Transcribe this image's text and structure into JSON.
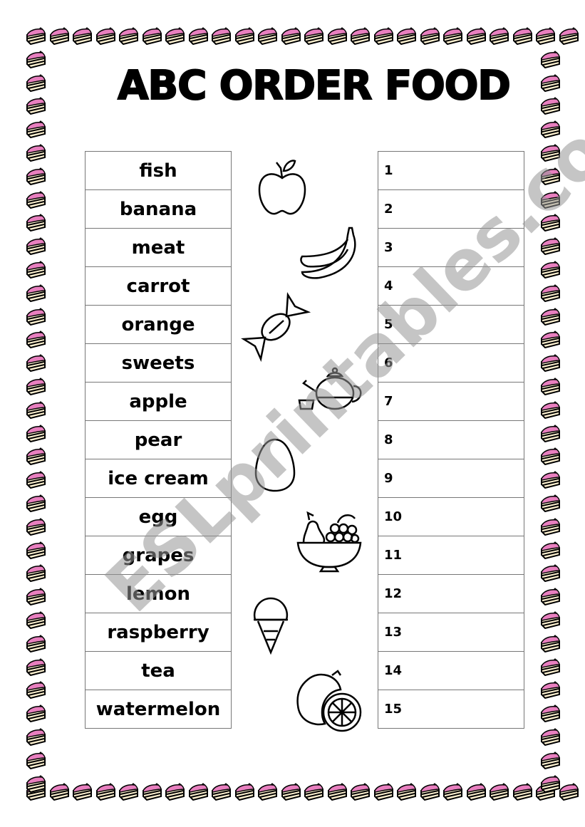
{
  "title": "ABC ORDER FOOD",
  "border_icon": "cake-slice-icon",
  "colors": {
    "cake_frosting": "#e87fbf",
    "cake_body": "#fff3d2",
    "watermark": "#969696"
  },
  "words": [
    "fish",
    "banana",
    "meat",
    "carrot",
    "orange",
    "sweets",
    "apple",
    "pear",
    "ice cream",
    "egg",
    "grapes",
    "lemon",
    "raspberry",
    "tea",
    "watermelon"
  ],
  "numbers": [
    "1",
    "2",
    "3",
    "4",
    "5",
    "6",
    "7",
    "8",
    "9",
    "10",
    "11",
    "12",
    "13",
    "14",
    "15"
  ],
  "food_icons": [
    "apple-icon",
    "banana-icon",
    "candy-icon",
    "teapot-icon",
    "egg-icon",
    "fruit-bowl-icon",
    "ice-cream-icon",
    "lemon-icon"
  ],
  "watermark": "ESLprintables.com"
}
